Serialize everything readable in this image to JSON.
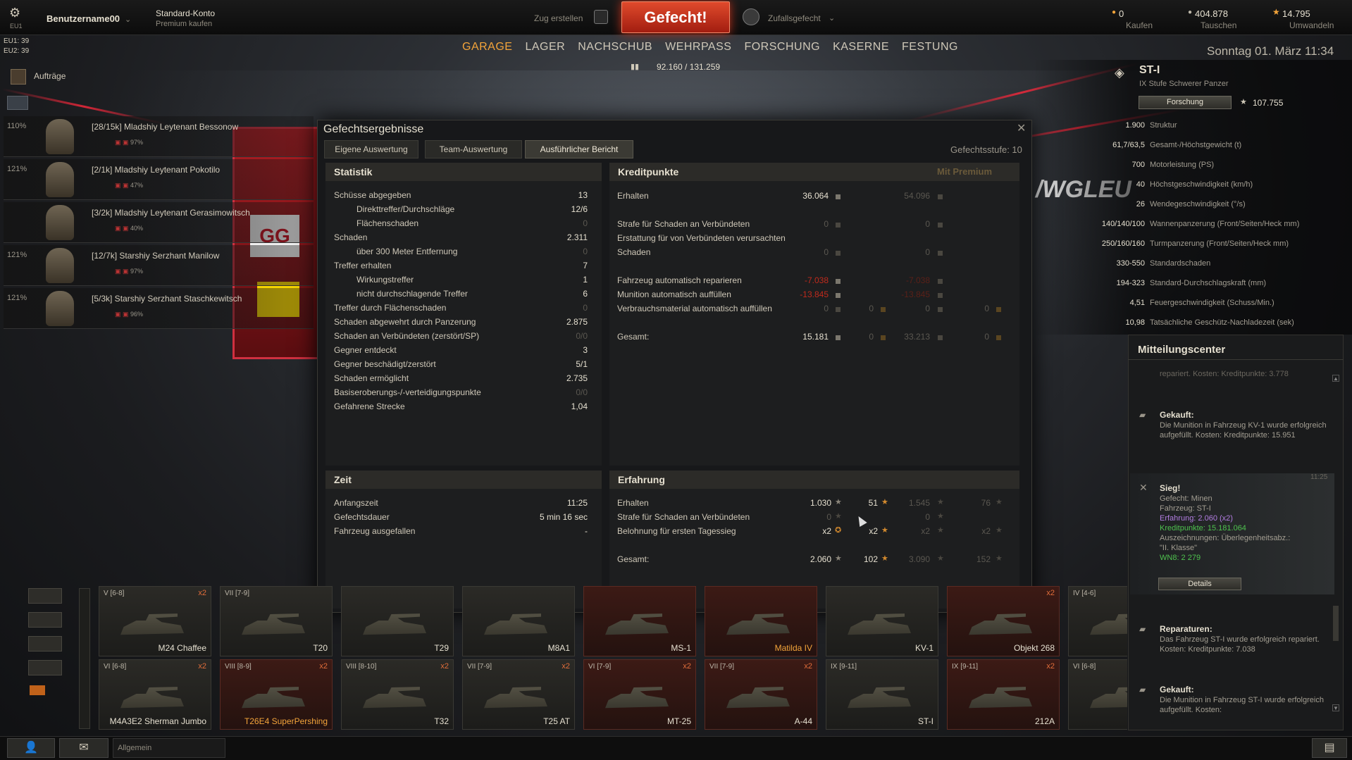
{
  "topbar": {
    "server": "EU1",
    "username": "Benutzername00",
    "account_type": "Standard-Konto",
    "premium_buy": "Premium kaufen",
    "platoon": "Zug erstellen",
    "fight": "Gefecht!",
    "battle_mode": "Zufallsgefecht",
    "gold": "0",
    "gold_action": "Kaufen",
    "credits": "404.878",
    "credits_action": "Tauschen",
    "free_xp": "14.795",
    "free_xp_action": "Umwandeln",
    "server_eu1": "EU1: 39",
    "server_eu2": "EU2: 39"
  },
  "nav": {
    "items": [
      "GARAGE",
      "LAGER",
      "NACHSCHUB",
      "WEHRPASS",
      "FORSCHUNG",
      "KASERNE",
      "FESTUNG"
    ],
    "xp_progress": "92.160 / 131.259"
  },
  "date": "Sonntag 01. März 11:34",
  "missions": "Aufträge",
  "crew": [
    {
      "pct": "110%",
      "name": "[28/15k] Mladshiy Leytenant Bessonow",
      "skill": "97%"
    },
    {
      "pct": "121%",
      "name": "[2/1k] Mladshiy Leytenant Pokotilo",
      "skill": "47%"
    },
    {
      "pct": "",
      "name": "[3/2k] Mladshiy Leytenant Gerasimowitsch",
      "skill": "40%"
    },
    {
      "pct": "121%",
      "name": "[12/7k] Starshiy Serzhant Manilow",
      "skill": "97%"
    },
    {
      "pct": "121%",
      "name": "[5/3k] Starshiy Serzhant Staschkewitsch",
      "skill": "96%"
    }
  ],
  "tank_info": {
    "name": "ST-I",
    "subtitle": "IX Stufe Schwerer Panzer",
    "research": "Forschung",
    "research_xp": "107.755",
    "stats": [
      {
        "v": "1.900",
        "l": "Struktur"
      },
      {
        "v": "61,7/63,5",
        "l": "Gesamt-/Höchstgewicht (t)"
      },
      {
        "v": "700",
        "l": "Motorleistung (PS)"
      },
      {
        "v": "40",
        "l": "Höchstgeschwindigkeit (km/h)"
      },
      {
        "v": "26",
        "l": "Wendegeschwindigkeit (°/s)"
      },
      {
        "v": "140/140/100",
        "l": "Wannenpanzerung (Front/Seiten/Heck mm)"
      },
      {
        "v": "250/160/160",
        "l": "Turmpanzerung (Front/Seiten/Heck mm)"
      },
      {
        "v": "330-550",
        "l": "Standardschaden"
      },
      {
        "v": "194-323",
        "l": "Standard-Durchschlagskraft (mm)"
      },
      {
        "v": "4,51",
        "l": "Feuergeschwindigkeit (Schuss/Min.)"
      },
      {
        "v": "10,98",
        "l": "Tatsächliche Geschütz-Nachladezeit (sek)"
      }
    ]
  },
  "dialog": {
    "title": "Gefechtsergebnisse",
    "tabs": [
      "Eigene Auswertung",
      "Team-Auswertung",
      "Ausführlicher Bericht"
    ],
    "tier": "Gefechtsstufe: 10",
    "statistik": {
      "title": "Statistik",
      "rows": [
        {
          "label": "Schüsse abgegeben",
          "value": "13",
          "indent": false,
          "dim": false
        },
        {
          "label": "Direkttreffer/Durchschläge",
          "value": "12/6",
          "indent": true,
          "dim": false
        },
        {
          "label": "Flächenschaden",
          "value": "0",
          "indent": true,
          "dim": true
        },
        {
          "label": "Schaden",
          "value": "2.311",
          "indent": false,
          "dim": false
        },
        {
          "label": "über 300 Meter Entfernung",
          "value": "0",
          "indent": true,
          "dim": true
        },
        {
          "label": "Treffer erhalten",
          "value": "7",
          "indent": false,
          "dim": false
        },
        {
          "label": "Wirkungstreffer",
          "value": "1",
          "indent": true,
          "dim": false
        },
        {
          "label": "nicht durchschlagende Treffer",
          "value": "6",
          "indent": true,
          "dim": false
        },
        {
          "label": "Treffer durch Flächenschaden",
          "value": "0",
          "indent": false,
          "dim": true
        },
        {
          "label": "Schaden abgewehrt durch Panzerung",
          "value": "2.875",
          "indent": false,
          "dim": false
        },
        {
          "label": "Schaden an Verbündeten (zerstört/SP)",
          "value": "0/0",
          "indent": false,
          "dim": true
        },
        {
          "label": "Gegner entdeckt",
          "value": "3",
          "indent": false,
          "dim": false
        },
        {
          "label": "Gegner beschädigt/zerstört",
          "value": "5/1",
          "indent": false,
          "dim": false
        },
        {
          "label": "Schaden ermöglicht",
          "value": "2.735",
          "indent": false,
          "dim": false
        },
        {
          "label": "Basiseroberungs-/-verteidigungspunkte",
          "value": "0/0",
          "indent": false,
          "dim": true
        },
        {
          "label": "Gefahrene Strecke",
          "value": "1,04",
          "indent": false,
          "dim": false
        }
      ]
    },
    "zeit": {
      "title": "Zeit",
      "rows": [
        {
          "label": "Anfangszeit",
          "value": "11:25"
        },
        {
          "label": "Gefechtsdauer",
          "value": "5 min 16 sec"
        },
        {
          "label": "Fahrzeug ausgefallen",
          "value": "-"
        }
      ]
    },
    "kredit": {
      "title": "Kreditpunkte",
      "premium": "Mit Premium",
      "erhalten": {
        "label": "Erhalten",
        "v": "36.064",
        "p": "54.096"
      },
      "strafe": {
        "label": "Strafe für Schaden an Verbündeten",
        "v": "0",
        "p": "0"
      },
      "erstattung1": "Erstattung für von Verbündeten verursachten",
      "erstattung2": {
        "label": "Schaden",
        "v": "0",
        "p": "0"
      },
      "repair": {
        "label": "Fahrzeug automatisch reparieren",
        "v": "-7.038",
        "p": "-7.038"
      },
      "ammo": {
        "label": "Munition automatisch auffüllen",
        "v": "-13.845",
        "p": "-13.845"
      },
      "consum": {
        "label": "Verbrauchsmaterial automatisch auffüllen",
        "v": "0",
        "g": "0",
        "p": "0",
        "pg": "0"
      },
      "gesamt": {
        "label": "Gesamt:",
        "v": "15.181",
        "g": "0",
        "p": "33.213",
        "pg": "0"
      }
    },
    "erfahrung": {
      "title": "Erfahrung",
      "erhalten": {
        "label": "Erhalten",
        "v": "1.030",
        "fx": "51",
        "p": "1.545",
        "pfx": "76"
      },
      "strafe": {
        "label": "Strafe für Schaden an Verbündeten",
        "v": "0",
        "p": "0"
      },
      "belohnung": {
        "label": "Belohnung für ersten Tagessieg",
        "v": "x2",
        "fx": "x2",
        "p": "x2",
        "pfx": "x2"
      },
      "gesamt": {
        "label": "Gesamt:",
        "v": "2.060",
        "fx": "102",
        "p": "3.090",
        "pfx": "152"
      }
    }
  },
  "notifications": {
    "title": "Mitteilungscenter",
    "prev": "repariert. Kosten: Kreditpunkte: 3.778",
    "items": [
      {
        "head": "Gekauft:",
        "text": "Die Munition in Fahrzeug KV-1 wurde erfolgreich aufgefüllt. Kosten: Kreditpunkte: 15.951"
      },
      {
        "head": "Sieg!",
        "time": "11:25",
        "l1": "Gefecht: Minen",
        "l2": "Fahrzeug: ST-I",
        "l3": "Erfahrung: 2.060 (x2)",
        "l4": "Kreditpunkte: 15.181.064",
        "l5": "Auszeichnungen: Überlegenheitsabz.: \"II. Klasse\"",
        "l6": "WN8: 2 279",
        "button": "Details"
      },
      {
        "head": "Reparaturen:",
        "text": "Das Fahrzeug ST-I wurde erfolgreich repariert. Kosten: Kreditpunkte: 7.038"
      },
      {
        "head": "Gekauft:",
        "text": "Die Munition in Fahrzeug ST-I wurde erfolgreich aufgefüllt. Kosten:"
      }
    ]
  },
  "carousel": [
    {
      "name": "M24 Chaffee",
      "tier": "V [6-8]",
      "x2": "x2",
      "prem": false,
      "gold": false
    },
    {
      "name": "T20",
      "tier": "VII [7-9]",
      "x2": "",
      "prem": false,
      "gold": false
    },
    {
      "name": "T29",
      "tier": "",
      "x2": "",
      "prem": false,
      "gold": false
    },
    {
      "name": "M8A1",
      "tier": "",
      "x2": "",
      "prem": false,
      "gold": false
    },
    {
      "name": "MS-1",
      "tier": "",
      "x2": "",
      "prem": true,
      "gold": false
    },
    {
      "name": "Matilda IV",
      "tier": "",
      "x2": "",
      "prem": true,
      "gold": true
    },
    {
      "name": "KV-1",
      "tier": "",
      "x2": "",
      "prem": false,
      "gold": false
    },
    {
      "name": "Objekt 268",
      "tier": "",
      "x2": "x2",
      "prem": true,
      "gold": false
    },
    {
      "name": "T",
      "tier": "IV [4-6]",
      "x2": "",
      "prem": false,
      "gold": false
    },
    {
      "name": "M4A3E2 Sherman Jumbo",
      "tier": "VI [6-8]",
      "x2": "x2",
      "prem": false,
      "gold": false
    },
    {
      "name": "T26E4 SuperPershing",
      "tier": "VIII [8-9]",
      "x2": "x2",
      "prem": true,
      "gold": true
    },
    {
      "name": "T32",
      "tier": "VIII [8-10]",
      "x2": "x2",
      "prem": false,
      "gold": false
    },
    {
      "name": "T25 AT",
      "tier": "VII [7-9]",
      "x2": "x2",
      "prem": false,
      "gold": false
    },
    {
      "name": "MT-25",
      "tier": "VI [7-9]",
      "x2": "x2",
      "prem": true,
      "gold": false
    },
    {
      "name": "A-44",
      "tier": "VII [7-9]",
      "x2": "x2",
      "prem": true,
      "gold": false
    },
    {
      "name": "ST-I",
      "tier": "IX [9-11]",
      "x2": "",
      "prem": false,
      "gold": false
    },
    {
      "name": "212A",
      "tier": "IX [9-11]",
      "x2": "x2",
      "prem": true,
      "gold": false
    },
    {
      "name": "T",
      "tier": "VI [6-8]",
      "x2": "",
      "prem": false,
      "gold": false
    }
  ],
  "chat": {
    "channel": "Allgemein"
  },
  "colors": {
    "accent": "#f3a43a",
    "fight": "#c0301a",
    "negative": "#c02a1c",
    "positive_green": "#4ec24e",
    "purple": "#b27de0"
  }
}
